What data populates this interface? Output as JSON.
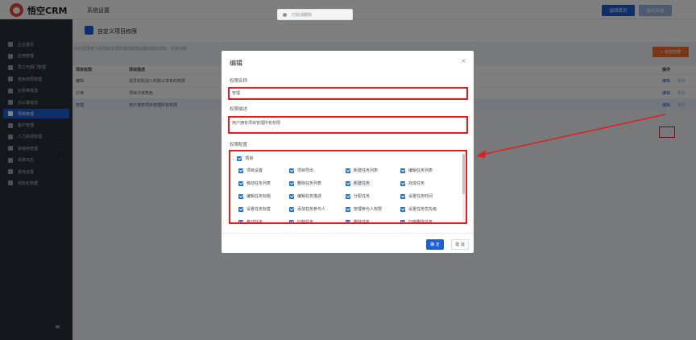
{
  "app": {
    "name": "悟空CRM",
    "section_title": "系统设置"
  },
  "toast": {
    "text": "已取消删除"
  },
  "header_buttons": {
    "home": "返回首页",
    "logout": "退出系统"
  },
  "sidebar": {
    "items": [
      {
        "label": "企业首页",
        "icon": "home-icon",
        "has_children": false,
        "active": false
      },
      {
        "label": "应用管理",
        "icon": "grid-icon",
        "has_children": false,
        "active": false
      },
      {
        "label": "员工与部门管理",
        "icon": "user-group-icon",
        "has_children": false,
        "active": false
      },
      {
        "label": "角色权限管理",
        "icon": "role-icon",
        "has_children": true,
        "active": false
      },
      {
        "label": "业务审批流",
        "icon": "approval-icon",
        "has_children": false,
        "active": false
      },
      {
        "label": "办公审批流",
        "icon": "office-approval-icon",
        "has_children": false,
        "active": false
      },
      {
        "label": "项目管理",
        "icon": "project-icon",
        "has_children": false,
        "active": true
      },
      {
        "label": "客户管理",
        "icon": "customer-icon",
        "has_children": true,
        "active": false
      },
      {
        "label": "人力资源管理",
        "icon": "hr-icon",
        "has_children": true,
        "active": false
      },
      {
        "label": "进销存管理",
        "icon": "inventory-icon",
        "has_children": true,
        "active": false
      },
      {
        "label": "系统日志",
        "icon": "log-icon",
        "has_children": true,
        "active": false
      },
      {
        "label": "其他设置",
        "icon": "gear-icon",
        "has_children": false,
        "active": false
      },
      {
        "label": "初始化数据",
        "icon": "chart-icon",
        "has_children": false,
        "active": false
      }
    ]
  },
  "page": {
    "title": "自定义项目权限",
    "tip": "为不同场景下的项目成员所需的权限设置匹配的项目。任务列表、",
    "tip_suffix": "任务的权限",
    "new_button": "+ 新建权限"
  },
  "table": {
    "headers": [
      "项目权限",
      "项目描述",
      "操作"
    ],
    "rows": [
      {
        "name": "编辑",
        "desc": "成员初始加入时默认享有的权限",
        "edit": "编辑",
        "delete": "删除"
      },
      {
        "name": "只读",
        "desc": "项目只读角色",
        "edit": "编辑",
        "delete": "删除"
      },
      {
        "name": "管理",
        "desc": "用户拥有项目管理所有权限",
        "edit": "编辑",
        "delete": "删除"
      }
    ]
  },
  "modal": {
    "title": "编辑",
    "close": "×",
    "name_label": "权限名称",
    "name_value": "管理",
    "desc_label": "权限描述",
    "desc_value": "用户拥有项目管理所有权限",
    "config_label": "权限配置",
    "root_label": "项目",
    "permissions": [
      [
        "项目设置",
        "项目导出",
        "新建任务列表",
        "编辑任务列表"
      ],
      [
        "移动任务列表",
        "删除任务列表",
        "新建任务",
        "完成任务"
      ],
      [
        "编辑任务标题",
        "编辑任务描述",
        "分配任务",
        "设置任务时间"
      ],
      [
        "设置任务标签",
        "添加任务参与人",
        "管理参与人权限",
        "设置任务优先级"
      ],
      [
        "移动任务",
        "归档任务",
        "删除任务",
        "归档删除任务"
      ]
    ],
    "ok_button": "确 定",
    "cancel_button": "取 消"
  },
  "colors": {
    "primary": "#1f5fd1",
    "accent_orange": "#f56c2a",
    "highlight_red": "#e02020",
    "sidebar_bg": "#282e39"
  }
}
